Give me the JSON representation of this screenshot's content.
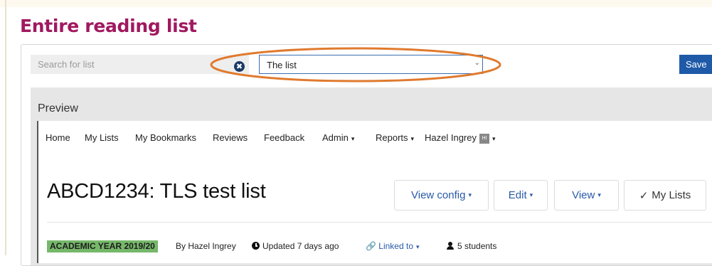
{
  "page": {
    "heading": "Entire reading list"
  },
  "search": {
    "placeholder": "Search for list",
    "clear_glyph": "✖"
  },
  "list_select": {
    "value": "The list",
    "caret": "⌄"
  },
  "save": {
    "label": "Save"
  },
  "preview": {
    "label": "Preview"
  },
  "nav": {
    "items": [
      {
        "label": "Home"
      },
      {
        "label": "My Lists"
      },
      {
        "label": "My Bookmarks"
      },
      {
        "label": "Reviews"
      },
      {
        "label": "Feedback"
      },
      {
        "label": "Admin"
      },
      {
        "label": "Reports"
      },
      {
        "label": "Hazel Ingrey"
      }
    ],
    "user_initials": "HI",
    "caret": "▾"
  },
  "list": {
    "title": "ABCD1234: TLS test list",
    "actions": [
      {
        "label": "View config"
      },
      {
        "label": "Edit"
      },
      {
        "label": "View"
      },
      {
        "label": "My Lists"
      }
    ],
    "check_glyph": "✓",
    "meta": {
      "academic_year": "ACADEMIC YEAR 2019/20",
      "author": "By Hazel Ingrey",
      "updated": "Updated 7 days ago",
      "linked": "Linked to",
      "students": "5 students"
    }
  },
  "icons": {
    "clear": "clear-search-icon",
    "clock": "clock-icon",
    "link": "link-icon",
    "user": "user-icon",
    "check": "check-icon"
  },
  "colors": {
    "heading": "#a0195f",
    "primary": "#1e5aa8",
    "annotation": "#e07a2e",
    "year_badge": "#76b86a"
  }
}
